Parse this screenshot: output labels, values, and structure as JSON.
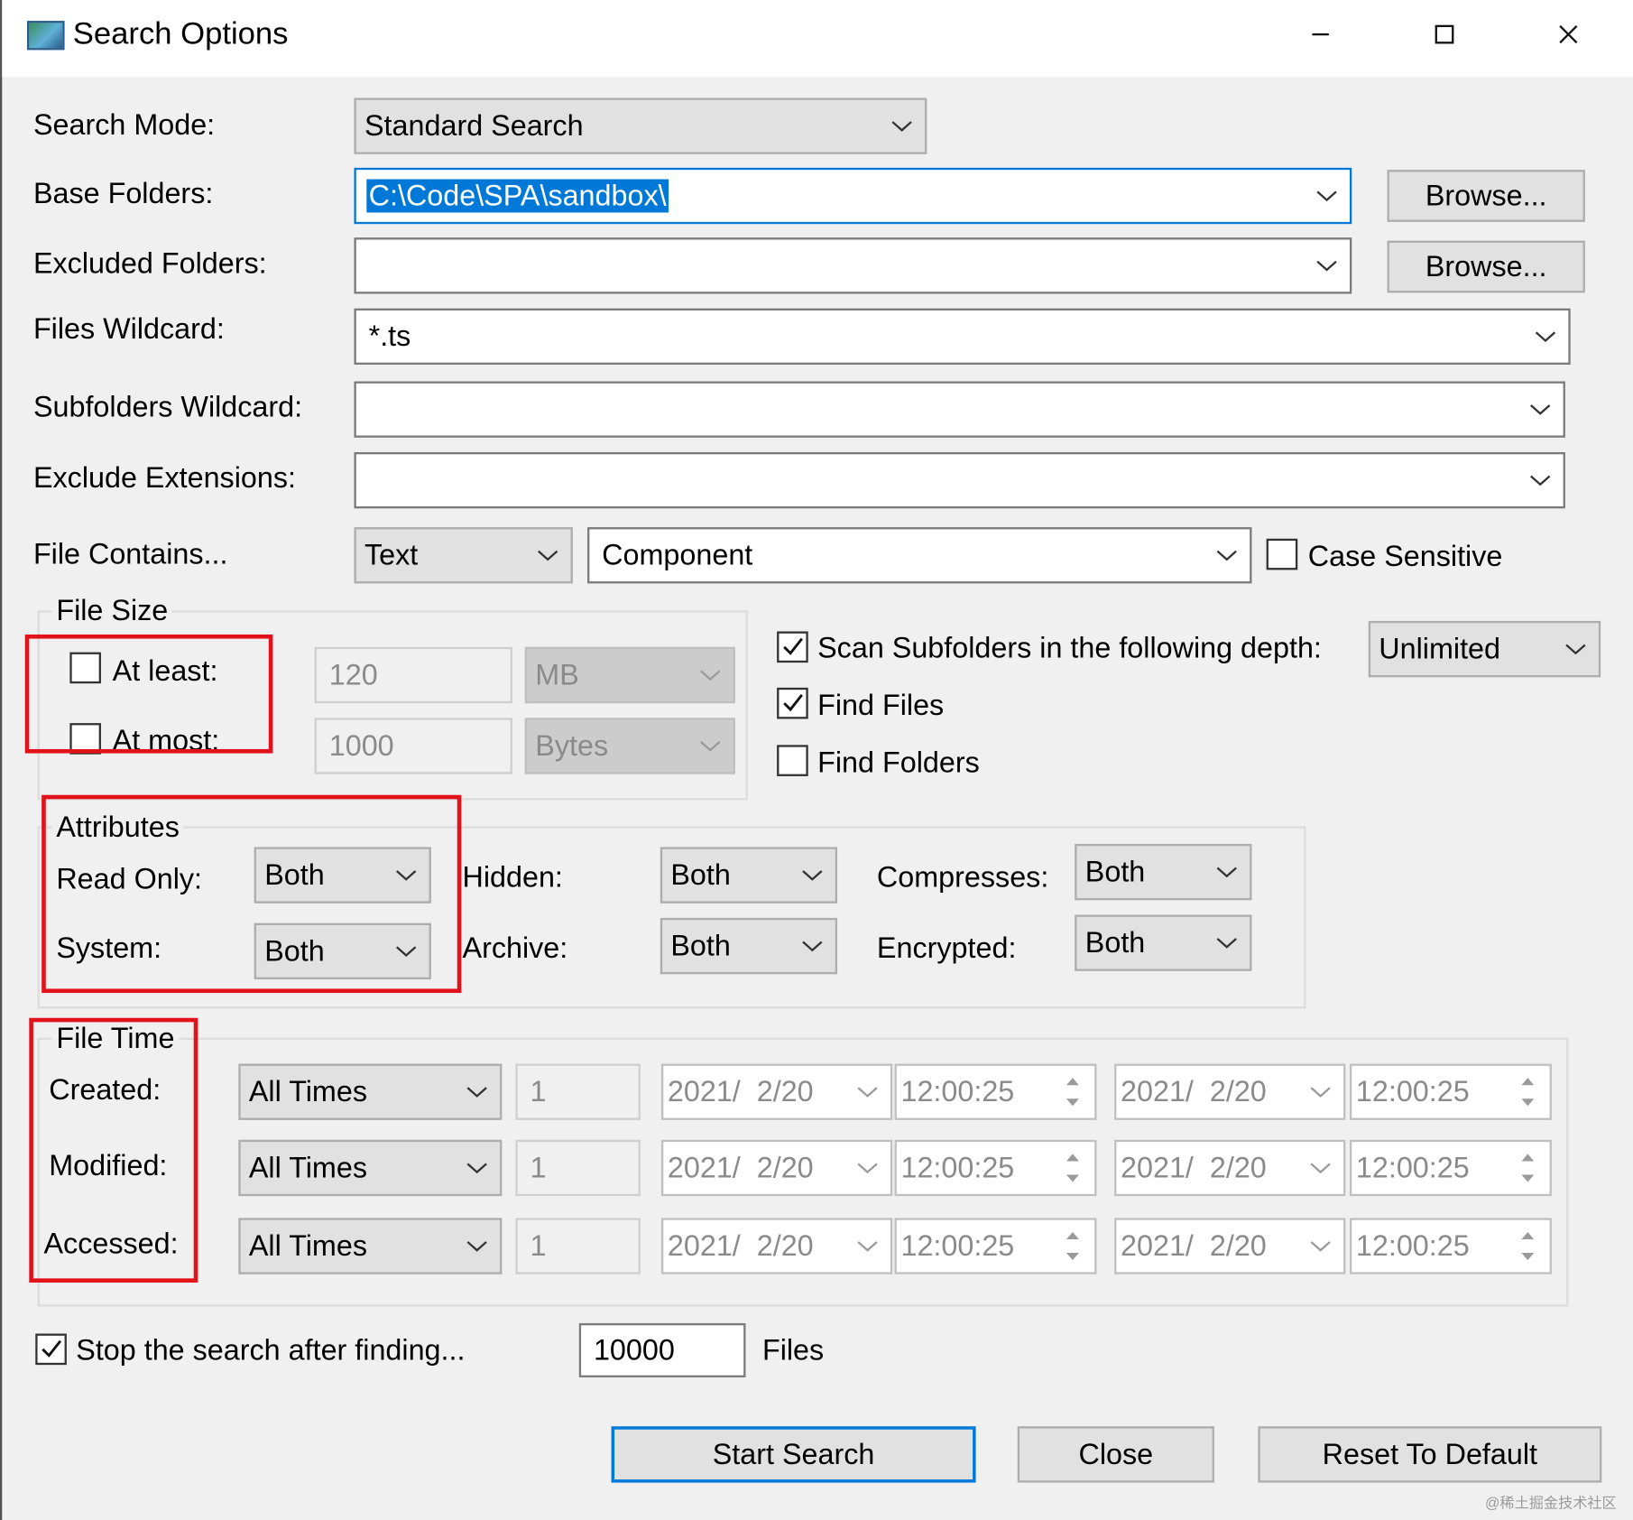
{
  "window": {
    "title": "Search Options",
    "minimize_icon": "minimize-icon",
    "maximize_icon": "maximize-icon",
    "close_icon": "close-icon"
  },
  "labels": {
    "search_mode": "Search Mode:",
    "base_folders": "Base Folders:",
    "excluded_folders": "Excluded Folders:",
    "files_wildcard": "Files Wildcard:",
    "subfolders_wildcard": "Subfolders Wildcard:",
    "exclude_extensions": "Exclude Extensions:",
    "file_contains": "File Contains..."
  },
  "search_mode": {
    "value": "Standard Search"
  },
  "base_folders": {
    "value": "C:\\Code\\SPA\\sandbox\\",
    "browse": "Browse..."
  },
  "excluded_folders": {
    "value": "",
    "browse": "Browse..."
  },
  "files_wildcard": {
    "value": "*.ts"
  },
  "subfolders_wildcard": {
    "value": ""
  },
  "exclude_extensions": {
    "value": ""
  },
  "file_contains": {
    "type": "Text",
    "value": "Component",
    "case_sensitive_label": "Case Sensitive",
    "case_sensitive": false
  },
  "file_size": {
    "group_title": "File Size",
    "at_least": {
      "label": "At least:",
      "checked": false,
      "value": "120",
      "unit": "MB"
    },
    "at_most": {
      "label": "At most:",
      "checked": false,
      "value": "1000",
      "unit": "Bytes"
    }
  },
  "scan": {
    "subfolders_label": "Scan Subfolders in the following depth:",
    "subfolders_checked": true,
    "depth": "Unlimited",
    "find_files_label": "Find Files",
    "find_files_checked": true,
    "find_folders_label": "Find Folders",
    "find_folders_checked": false
  },
  "attributes": {
    "group_title": "Attributes",
    "read_only": {
      "label": "Read Only:",
      "value": "Both"
    },
    "system": {
      "label": "System:",
      "value": "Both"
    },
    "hidden": {
      "label": "Hidden:",
      "value": "Both"
    },
    "archive": {
      "label": "Archive:",
      "value": "Both"
    },
    "compresses": {
      "label": "Compresses:",
      "value": "Both"
    },
    "encrypted": {
      "label": "Encrypted:",
      "value": "Both"
    }
  },
  "file_time": {
    "group_title": "File Time",
    "rows": [
      {
        "label": "Created:",
        "mode": "All Times",
        "count": "1",
        "from_date": "2021/  2/20",
        "from_time": "12:00:25",
        "to_date": "2021/  2/20",
        "to_time": "12:00:25"
      },
      {
        "label": "Modified:",
        "mode": "All Times",
        "count": "1",
        "from_date": "2021/  2/20",
        "from_time": "12:00:25",
        "to_date": "2021/  2/20",
        "to_time": "12:00:25"
      },
      {
        "label": "Accessed:",
        "mode": "All Times",
        "count": "1",
        "from_date": "2021/  2/20",
        "from_time": "12:00:25",
        "to_date": "2021/  2/20",
        "to_time": "12:00:25"
      }
    ]
  },
  "stop": {
    "label": "Stop the search after finding...",
    "checked": true,
    "value": "10000",
    "suffix": "Files"
  },
  "buttons": {
    "start": "Start Search",
    "close": "Close",
    "reset": "Reset To Default"
  },
  "watermark": "@稀土掘金技术社区",
  "colors": {
    "accent": "#0078d7",
    "highlight_box": "#e2121b",
    "dialog_bg": "#f0f0f0"
  }
}
